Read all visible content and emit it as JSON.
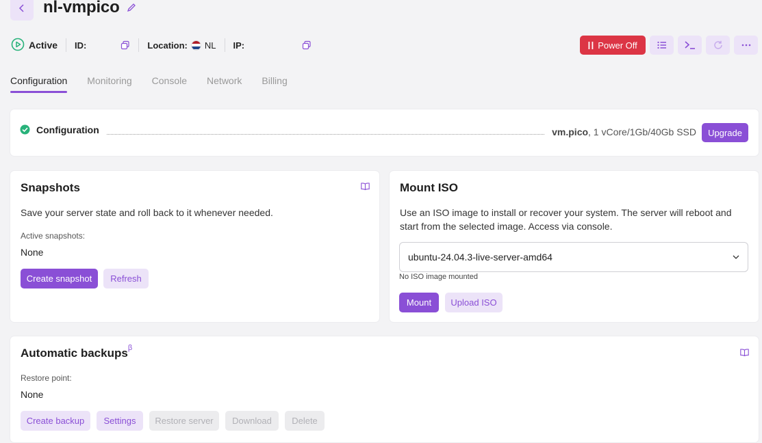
{
  "header": {
    "title": "nl-vmpico",
    "status": "Active",
    "id_label": "ID:",
    "location_label": "Location:",
    "location_code": "NL",
    "ip_label": "IP:",
    "power_off_label": "Power Off"
  },
  "tabs": [
    {
      "label": "Configuration",
      "active": true
    },
    {
      "label": "Monitoring",
      "active": false
    },
    {
      "label": "Console",
      "active": false
    },
    {
      "label": "Network",
      "active": false
    },
    {
      "label": "Billing",
      "active": false
    }
  ],
  "configuration": {
    "label": "Configuration",
    "plan": "vm.pico",
    "spec": ", 1 vCore/1Gb/40Gb SSD",
    "upgrade_label": "Upgrade"
  },
  "snapshots": {
    "title": "Snapshots",
    "description": "Save your server state and roll back to it whenever needed.",
    "active_label": "Active snapshots:",
    "active_value": "None",
    "create_label": "Create snapshot",
    "refresh_label": "Refresh"
  },
  "mount_iso": {
    "title": "Mount ISO",
    "description": "Use an ISO image to install or recover your system. The server will reboot and start from the selected image. Access via console.",
    "selected_image": "ubuntu-24.04.3-live-server-amd64",
    "hint": "No ISO image mounted",
    "mount_label": "Mount",
    "upload_label": "Upload ISO"
  },
  "backups": {
    "title": "Automatic backups",
    "beta": "β",
    "restore_label": "Restore point:",
    "restore_value": "None",
    "create_label": "Create backup",
    "settings_label": "Settings",
    "restore_server_label": "Restore server",
    "download_label": "Download",
    "delete_label": "Delete"
  },
  "colors": {
    "accent": "#8a4fd6",
    "accent_light": "#ece3f8",
    "danger": "#dc3545",
    "success": "#28b27a"
  }
}
